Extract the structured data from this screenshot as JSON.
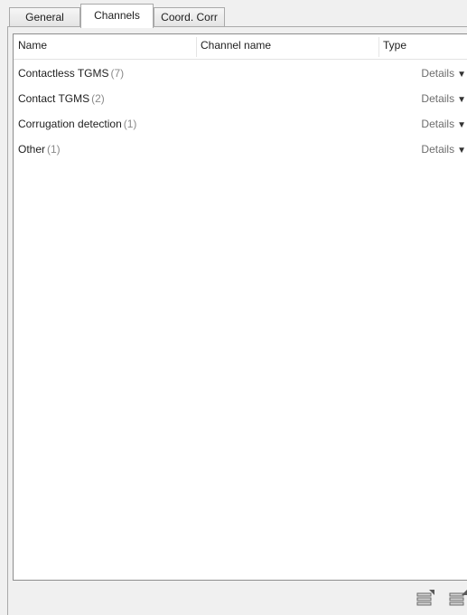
{
  "tabs": [
    {
      "label": "General"
    },
    {
      "label": "Channels"
    },
    {
      "label": "Coord. Corr"
    }
  ],
  "list": {
    "columns": {
      "name": "Name",
      "channel_name": "Channel name",
      "type": "Type"
    },
    "groups": [
      {
        "name": "Contactless TGMS",
        "count": "(7)",
        "details": "Details"
      },
      {
        "name": "Contact TGMS",
        "count": "(2)",
        "details": "Details"
      },
      {
        "name": "Corrugation detection",
        "count": "(1)",
        "details": "Details"
      },
      {
        "name": "Other",
        "count": "(1)",
        "details": "Details"
      }
    ]
  },
  "toolbar": {
    "icons": [
      "list-expand-icon",
      "list-collapse-icon"
    ]
  }
}
